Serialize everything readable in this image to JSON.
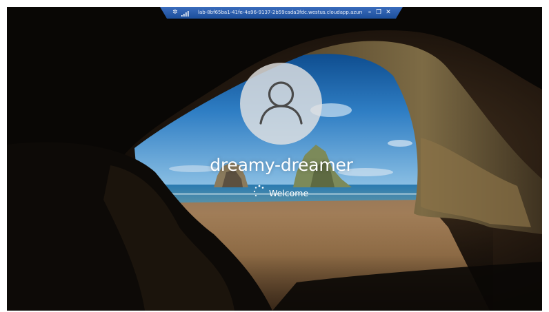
{
  "rdp_bar": {
    "pin_glyph": "✲",
    "title": "lab-8bf65ba1-41fe-4a96-9137-2b59cada3fdc.westus.cloudapp.azure...",
    "minimize_glyph": "–",
    "restore_glyph": "❐",
    "close_glyph": "✕",
    "icons": [
      "pin-icon",
      "connection-quality-icon",
      "minimize-icon",
      "restore-icon",
      "close-icon"
    ]
  },
  "lock_screen": {
    "username": "dreamy-dreamer",
    "status": "Welcome",
    "icons": [
      "user-avatar-icon",
      "loading-spinner-icon"
    ]
  },
  "colors": {
    "rdp_bar": "#1c4f9c",
    "ocean": "#1d6fa6",
    "sand": "#b58a5c",
    "rock": "#3d2e1f",
    "text": "#ffffff"
  }
}
